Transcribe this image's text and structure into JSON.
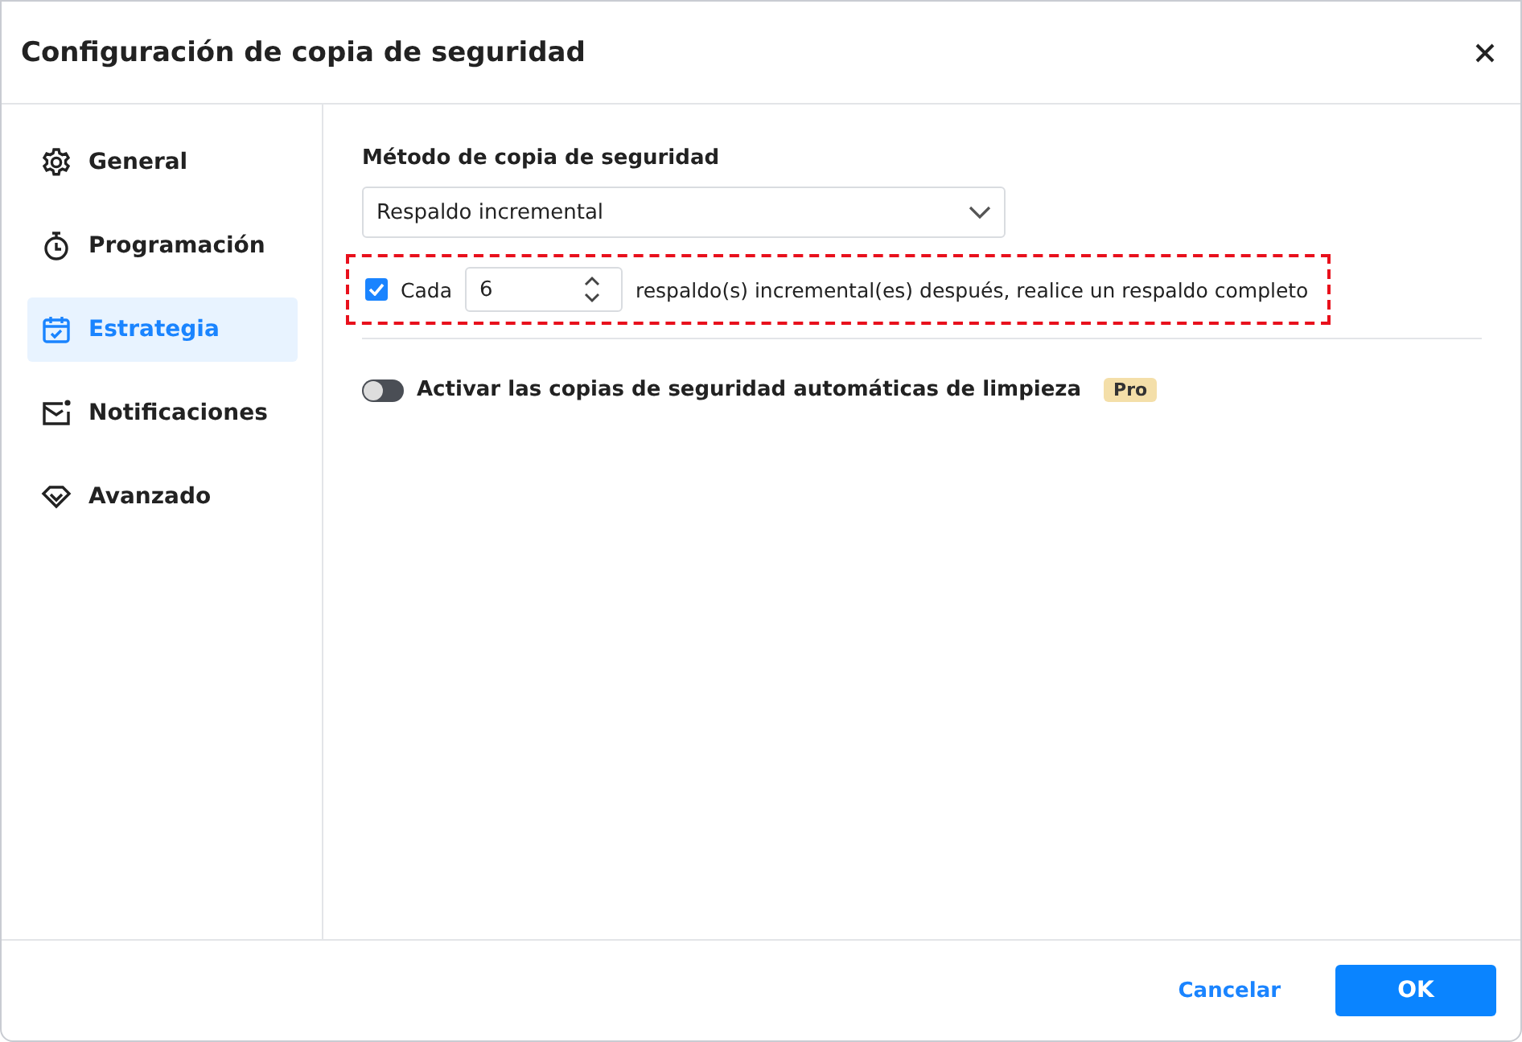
{
  "window": {
    "title": "Configuración de copia de seguridad"
  },
  "sidebar": {
    "items": [
      {
        "label": "General",
        "selected": false
      },
      {
        "label": "Programación",
        "selected": false
      },
      {
        "label": "Estrategia",
        "selected": true
      },
      {
        "label": "Notificaciones",
        "selected": false
      },
      {
        "label": "Avanzado",
        "selected": false
      }
    ]
  },
  "method": {
    "label": "Método de copia de seguridad",
    "value": "Respaldo incremental"
  },
  "full_backup": {
    "checked": true,
    "highlighted": true,
    "prefix": "Cada",
    "count": "6",
    "suffix": "respaldo(s) incremental(es) después, realice un respaldo completo"
  },
  "cleanup": {
    "on": false,
    "label": "Activar las copias de seguridad automáticas de limpieza",
    "badge": "Pro"
  },
  "buttons": {
    "cancel": "Cancelar",
    "ok": "OK"
  }
}
